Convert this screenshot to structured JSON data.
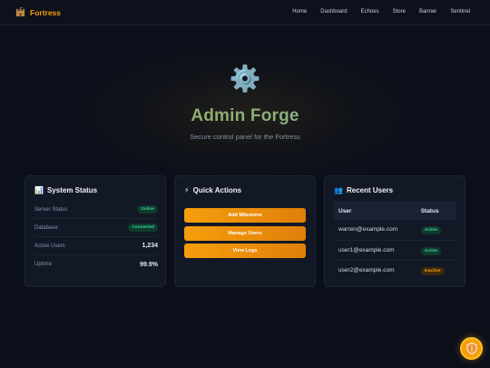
{
  "brand": {
    "icon": "castle-icon",
    "name": "Fortress"
  },
  "nav": {
    "links": [
      "Home",
      "Dashboard",
      "Echoes",
      "Store",
      "Banner",
      "Sentinel"
    ]
  },
  "hero": {
    "icon": "gear-icon",
    "icon_glyph": "⚙️",
    "title": "Admin Forge",
    "subtitle": "Secure control panel for the Fortress"
  },
  "system_status": {
    "icon_glyph": "📊",
    "title": "System Status",
    "rows": [
      {
        "label": "Server Status",
        "value": "Online",
        "kind": "badge"
      },
      {
        "label": "Database",
        "value": "Connected",
        "kind": "badge"
      },
      {
        "label": "Active Users",
        "value": "1,234",
        "kind": "text"
      },
      {
        "label": "Uptime",
        "value": "99.9%",
        "kind": "text"
      }
    ]
  },
  "quick_actions": {
    "icon_glyph": "⚡",
    "title": "Quick Actions",
    "buttons": [
      "Add Milestone",
      "Manage Users",
      "View Logs"
    ]
  },
  "recent_users": {
    "icon_glyph": "👥",
    "title": "Recent Users",
    "columns": [
      "User",
      "Status"
    ],
    "rows": [
      {
        "user": "warren@example.com",
        "status": "Active"
      },
      {
        "user": "user1@example.com",
        "status": "Active"
      },
      {
        "user": "user2@example.com",
        "status": "Inactive"
      }
    ]
  },
  "fab": {
    "icon": "shield-icon",
    "icon_glyph": "🛡️"
  },
  "colors": {
    "accent": "#f59e0b",
    "success": "#34d399",
    "background": "#0b0f1a",
    "card": "#121826"
  }
}
